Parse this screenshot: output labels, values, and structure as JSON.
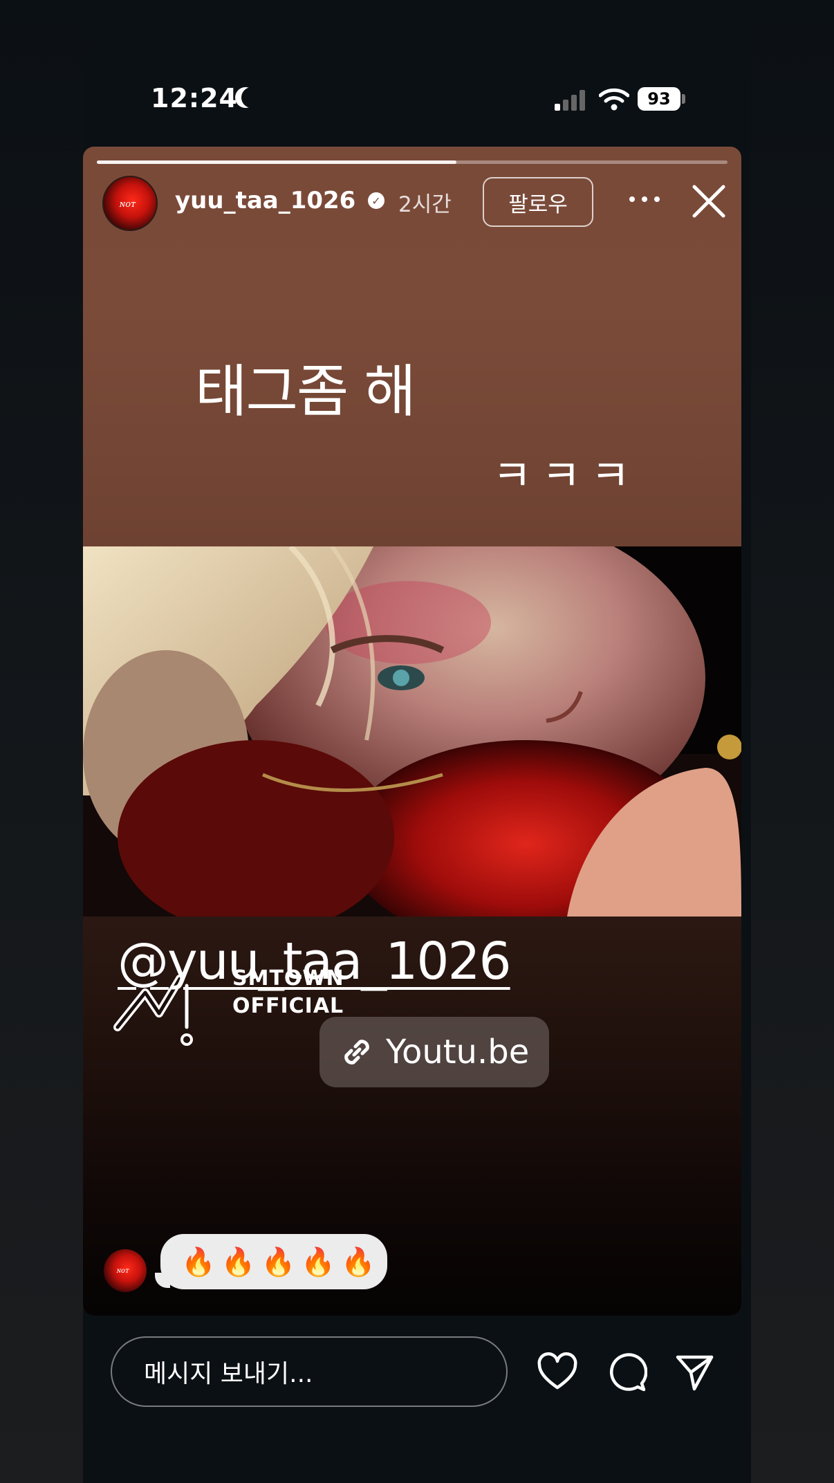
{
  "status_bar": {
    "time": "12:24",
    "battery": "93",
    "icons": [
      "moon-icon",
      "signal-icon",
      "wifi-icon",
      "battery-icon"
    ]
  },
  "story": {
    "progress": 0.57,
    "username": "yuu_taa_1026",
    "time_ago": "2시간",
    "follow_label": "팔로우",
    "text_line1": "태그좀 해",
    "text_line2": "ㅋㅋㅋ",
    "logo_line1": "SMTOWN",
    "logo_line2": "OFFICIAL",
    "mention": "@yuu_taa_1026",
    "link_label": "Youtu.be",
    "reply_emojis": "🔥🔥🔥🔥🔥",
    "icons": [
      "verified-icon",
      "more-icon",
      "close-icon",
      "link-icon"
    ]
  },
  "bottom_bar": {
    "message_placeholder": "메시지 보내기...",
    "icons": [
      "heart-icon",
      "comment-icon",
      "send-icon"
    ]
  },
  "colors": {
    "background": "#0b1014",
    "story_top": "#7a4a39",
    "story_bottom": "#050303"
  }
}
